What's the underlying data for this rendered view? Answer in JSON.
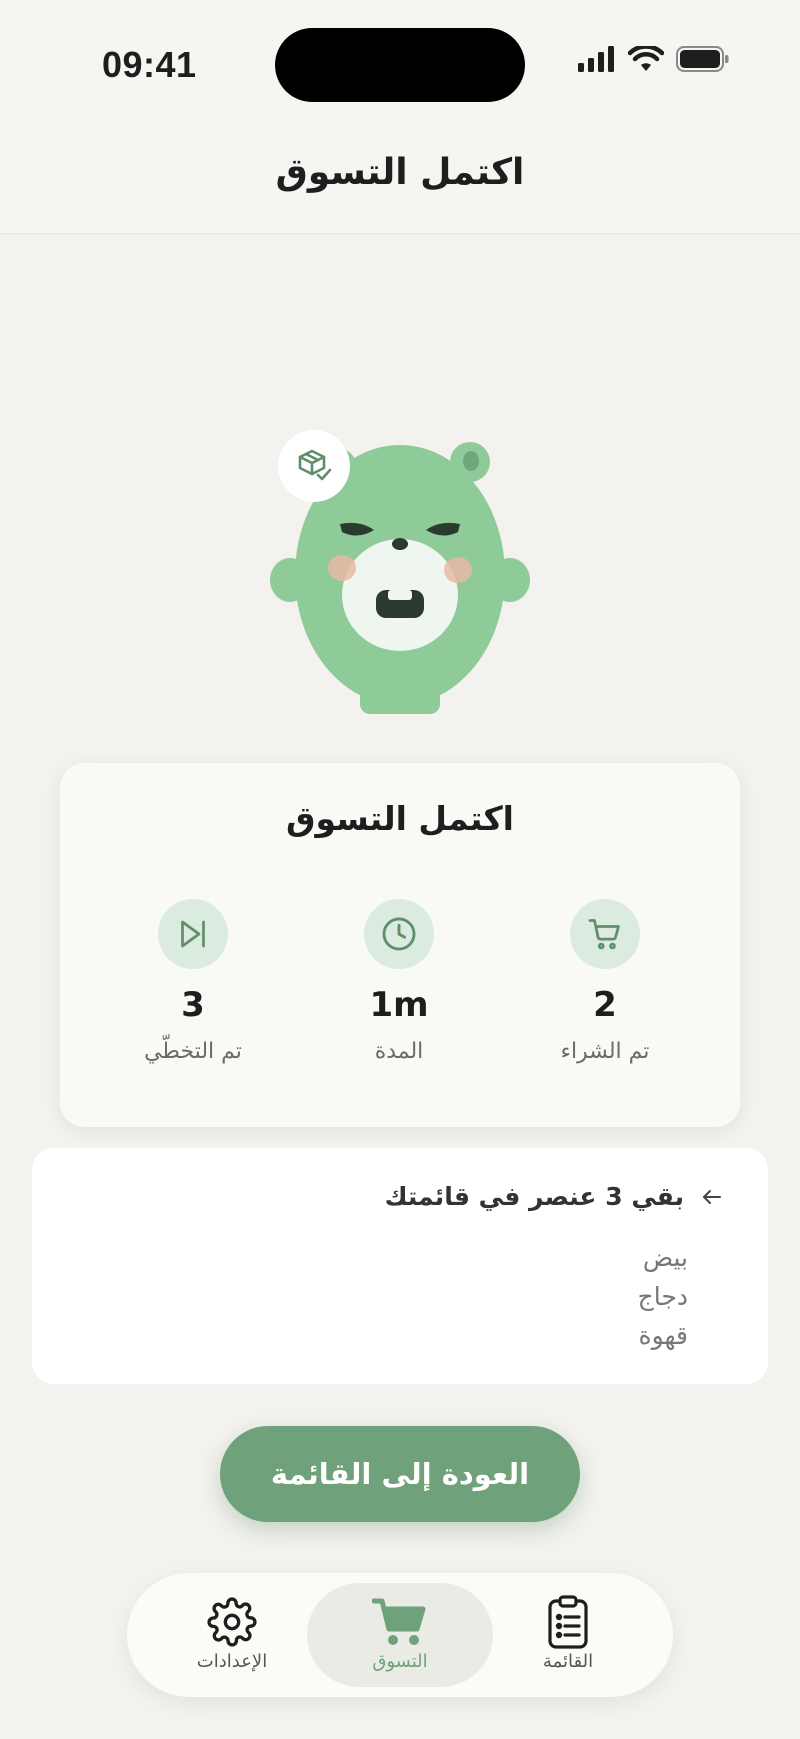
{
  "status_bar": {
    "time": "09:41"
  },
  "header": {
    "title": "اكتمل التسوق"
  },
  "summary": {
    "title": "اكتمل التسوق",
    "stats": [
      {
        "icon": "cart-icon",
        "value": "2",
        "label": "تم الشراء"
      },
      {
        "icon": "clock-icon",
        "value": "1m",
        "label": "المدة"
      },
      {
        "icon": "skip-forward-icon",
        "value": "3",
        "label": "تم التخطّي"
      }
    ]
  },
  "remaining": {
    "title": "بقي 3 عنصر في قائمتك",
    "items": [
      "بيض",
      "دجاج",
      "قهوة"
    ]
  },
  "actions": {
    "back_label": "العودة إلى القائمة"
  },
  "tabbar": {
    "tabs": [
      {
        "label": "القائمة",
        "icon": "clipboard-list-icon"
      },
      {
        "label": "التسوق",
        "icon": "cart-icon",
        "active": true
      },
      {
        "label": "الإعدادات",
        "icon": "gear-icon"
      }
    ]
  },
  "colors": {
    "accent": "#6fa27a",
    "mascot": "#8fcb98",
    "background": "#f3f2ee"
  }
}
